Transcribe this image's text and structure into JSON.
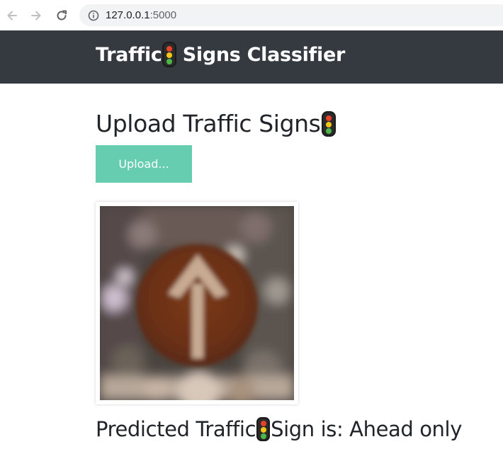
{
  "browser": {
    "url_host": "127.0.0.1",
    "url_port": ":5000",
    "back_icon": "arrow-left-icon",
    "forward_icon": "arrow-right-icon",
    "reload_icon": "reload-icon",
    "info_icon": "info-icon"
  },
  "navbar": {
    "brand_before": "Traffic",
    "brand_after": " Signs Classifier",
    "background": "#343a40"
  },
  "main": {
    "heading": "Upload Traffic Signs",
    "upload_label": "Upload...",
    "upload_color": "#66cdb0",
    "image_alt": "Uploaded traffic sign: round brown sign with upward arrow",
    "prediction_before": "Predicted Traffic",
    "prediction_after": "Sign is: Ahead only"
  },
  "icons": {
    "traffic_light": "traffic-light-icon"
  }
}
